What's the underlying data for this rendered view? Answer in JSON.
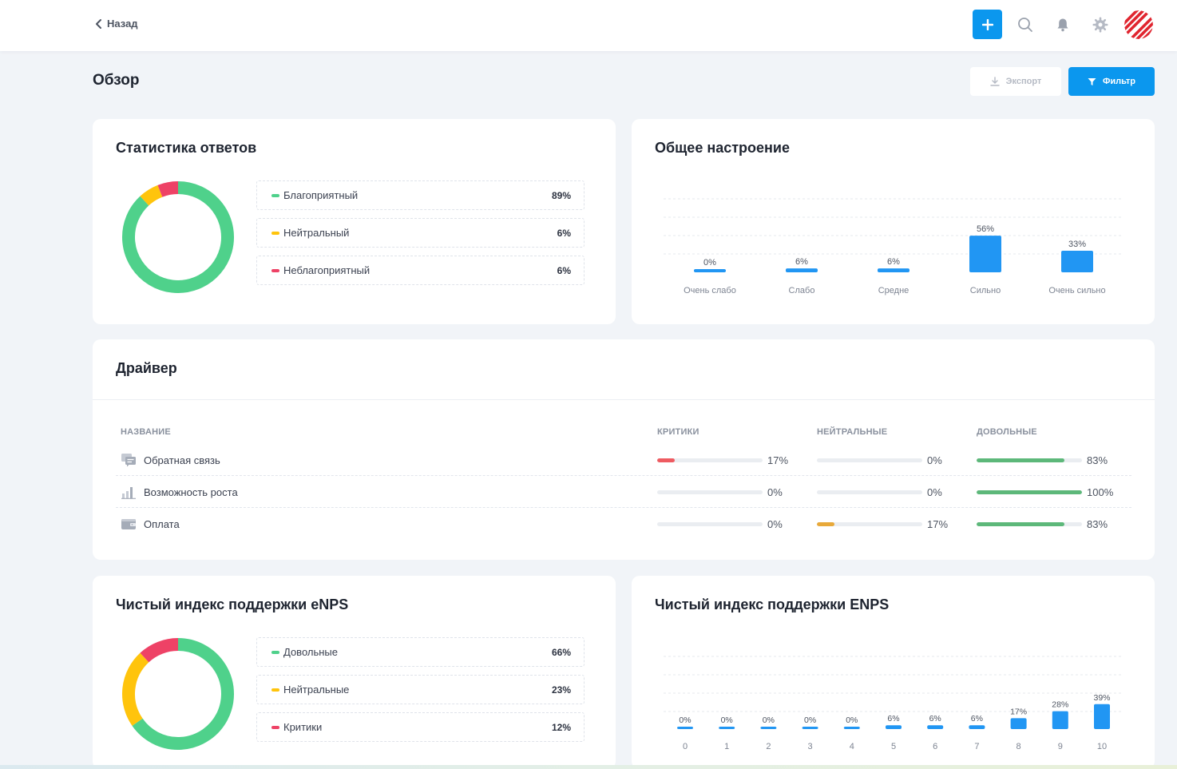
{
  "header": {
    "back_label": "Назад",
    "add_icon": "plus-icon",
    "search_icon": "search-icon",
    "bell_icon": "bell-icon",
    "settings_icon": "gear-icon"
  },
  "page": {
    "title": "Обзор",
    "export_label": "Экспорт",
    "filter_label": "Фильтр"
  },
  "colors": {
    "accent": "#0b97ee",
    "favorable": "#4fd18b",
    "neutral": "#ffc40c",
    "unfavorable": "#ee4266",
    "bar": "#2196f3"
  },
  "response_stats": {
    "title": "Статистика ответов",
    "items": [
      {
        "label": "Благоприятный",
        "value": "89%",
        "color": "#4fd18b"
      },
      {
        "label": "Нейтральный",
        "value": "6%",
        "color": "#ffc40c"
      },
      {
        "label": "Неблагоприятный",
        "value": "6%",
        "color": "#ee4266"
      }
    ]
  },
  "mood": {
    "title": "Общее настроение"
  },
  "driver": {
    "title": "Драйвер",
    "columns": {
      "name": "НАЗВАНИЕ",
      "critics": "КРИТИКИ",
      "neutral": "НЕЙТРАЛЬНЫЕ",
      "satisfied": "ДОВОЛЬНЫЕ"
    },
    "rows": [
      {
        "name": "Обратная связь",
        "icon": "feedback-icon",
        "critics": "17%",
        "neutral": "0%",
        "satisfied": "83%",
        "critics_value": 17,
        "neutral_value": 0,
        "satisfied_value": 83
      },
      {
        "name": "Возможность роста",
        "icon": "growth-chart-icon",
        "critics": "0%",
        "neutral": "0%",
        "satisfied": "100%",
        "critics_value": 0,
        "neutral_value": 0,
        "satisfied_value": 100
      },
      {
        "name": "Оплата",
        "icon": "wallet-icon",
        "critics": "0%",
        "neutral": "17%",
        "satisfied": "83%",
        "critics_value": 0,
        "neutral_value": 17,
        "satisfied_value": 83
      }
    ]
  },
  "enps_stats": {
    "title": "Чистый индекс поддержки eNPS",
    "items": [
      {
        "label": "Довольные",
        "value": "66%",
        "color": "#4fd18b"
      },
      {
        "label": "Нейтральные",
        "value": "23%",
        "color": "#ffc40c"
      },
      {
        "label": "Критики",
        "value": "12%",
        "color": "#ee4266"
      }
    ]
  },
  "enps_dist": {
    "title": "Чистый индекс поддержки ENPS"
  },
  "chart_data": [
    {
      "type": "pie",
      "title": "Статистика ответов",
      "categories": [
        "Благоприятный",
        "Нейтральный",
        "Неблагоприятный"
      ],
      "values": [
        89,
        6,
        6
      ]
    },
    {
      "type": "bar",
      "title": "Общее настроение",
      "categories": [
        "Очень слабо",
        "Слабо",
        "Средне",
        "Сильно",
        "Очень сильно"
      ],
      "values": [
        0,
        6,
        6,
        56,
        33
      ],
      "labels": [
        "0%",
        "6%",
        "6%",
        "56%",
        "33%"
      ],
      "ylim": [
        0,
        100
      ],
      "grid": true
    },
    {
      "type": "pie",
      "title": "Чистый индекс поддержки eNPS",
      "categories": [
        "Довольные",
        "Нейтральные",
        "Критики"
      ],
      "values": [
        66,
        23,
        12
      ]
    },
    {
      "type": "bar",
      "title": "Чистый индекс поддержки ENPS",
      "categories": [
        "0",
        "1",
        "2",
        "3",
        "4",
        "5",
        "6",
        "7",
        "8",
        "9",
        "10"
      ],
      "values": [
        0,
        0,
        0,
        0,
        0,
        6,
        6,
        6,
        17,
        28,
        39
      ],
      "labels": [
        "0%",
        "0%",
        "0%",
        "0%",
        "0%",
        "6%",
        "6%",
        "6%",
        "17%",
        "28%",
        "39%"
      ],
      "ylim": [
        0,
        100
      ],
      "grid": true
    }
  ]
}
